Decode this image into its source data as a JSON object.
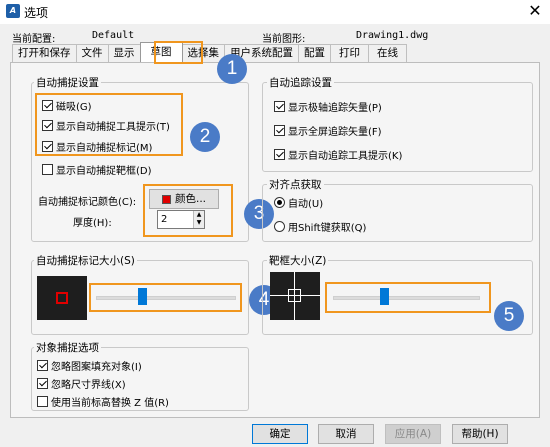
{
  "window": {
    "title": "选项",
    "app_icon": "A"
  },
  "profile": {
    "current_config_label": "当前配置:",
    "current_config_value": "Default",
    "current_drawing_label": "当前图形:",
    "current_drawing_value": "Drawing1.dwg"
  },
  "tabs": [
    "打开和保存",
    "文件",
    "显示",
    "草图",
    "选择集",
    "用户系统配置",
    "配置",
    "打印",
    "在线"
  ],
  "autosnap": {
    "title": "自动捕捉设置",
    "options": [
      {
        "label": "磁吸(G)",
        "checked": true
      },
      {
        "label": "显示自动捕捉工具提示(T)",
        "checked": true
      },
      {
        "label": "显示自动捕捉标记(M)",
        "checked": true
      },
      {
        "label": "显示自动捕捉靶框(D)",
        "checked": false
      }
    ],
    "color_label": "自动捕捉标记颜色(C):",
    "color_button": "颜色...",
    "color_swatch": "#e00000",
    "thickness_label": "厚度(H):",
    "thickness_value": "2"
  },
  "autotrack": {
    "title": "自动追踪设置",
    "options": [
      {
        "label": "显示极轴追踪矢量(P)",
        "checked": true
      },
      {
        "label": "显示全屏追踪矢量(F)",
        "checked": true
      },
      {
        "label": "显示自动追踪工具提示(K)",
        "checked": true
      }
    ]
  },
  "alignment": {
    "title": "对齐点获取",
    "options": [
      {
        "label": "自动(U)",
        "selected": true
      },
      {
        "label": "用Shift键获取(Q)",
        "selected": false
      }
    ]
  },
  "marker_size": {
    "title": "自动捕捉标记大小(S)",
    "level": 0.33
  },
  "aperture_size": {
    "title": "靶框大小(Z)",
    "level": 0.35
  },
  "object_snap": {
    "title": "对象捕捉选项",
    "options": [
      {
        "label": "忽略图案填充对象(I)",
        "checked": true
      },
      {
        "label": "忽略尺寸界线(X)",
        "checked": true
      },
      {
        "label": "使用当前标高替换 Z 值(R)",
        "checked": false
      }
    ]
  },
  "badges": [
    "1",
    "2",
    "3",
    "4",
    "5"
  ],
  "buttons": {
    "ok": "确定",
    "cancel": "取消",
    "apply": "应用(A)",
    "help": "帮助(H)"
  },
  "colors": {
    "highlight": "#f0961e",
    "badge": "#4a7bc7",
    "accent": "#0078d7"
  }
}
